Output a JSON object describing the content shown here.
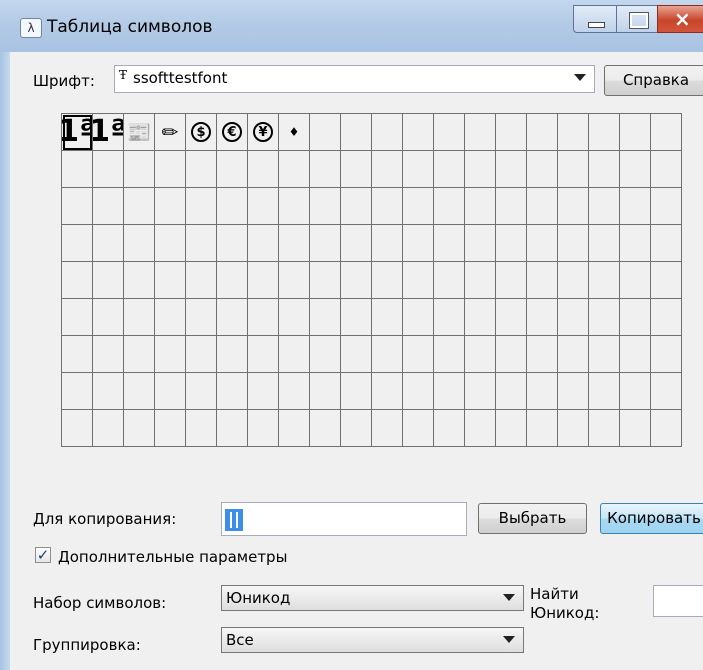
{
  "window": {
    "title": "Таблица символов",
    "app_icon": "λ",
    "icons": {
      "minimize": "minimize-icon",
      "maximize": "maximize-icon",
      "close": "close-icon"
    }
  },
  "font": {
    "label": "Шрифт:",
    "selected": "ssofttestfont",
    "font_type_glyph": "Ŧ"
  },
  "help_button": "Справка",
  "grid": {
    "columns": 20,
    "rows": 9,
    "selected_index": 0,
    "glyphs": [
      "1ª",
      "1ª",
      "📰",
      "✏",
      "$",
      "€",
      "¥",
      "♦"
    ]
  },
  "copy": {
    "label": "Для копирования:",
    "value": "",
    "select_button": "Выбрать",
    "copy_button": "Копировать"
  },
  "advanced": {
    "label": "Дополнительные параметры",
    "checked": true,
    "check_glyph": "✓"
  },
  "charset": {
    "label": "Набор символов:",
    "value": "Юникод"
  },
  "find_unicode": {
    "label_line1": "Найти",
    "label_line2": "Юникод:",
    "value": ""
  },
  "grouping": {
    "label": "Группировка:",
    "value": "Все"
  }
}
